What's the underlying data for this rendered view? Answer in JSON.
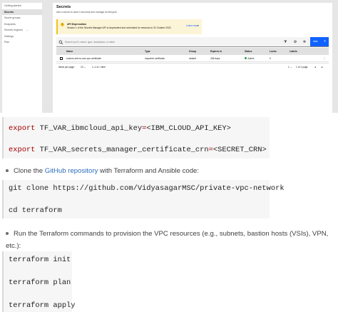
{
  "sidebar": {
    "items": [
      {
        "label": "Getting started"
      },
      {
        "label": "Secrets"
      },
      {
        "label": "Secret groups"
      },
      {
        "label": "Endpoints"
      },
      {
        "label": "Secrets engines"
      },
      {
        "label": "Settings"
      },
      {
        "label": "Plan"
      }
    ]
  },
  "page": {
    "title": "Secrets",
    "subtitle": "Add a secret to store it securely and manage its lifecycle."
  },
  "notice": {
    "title": "API Deprecation",
    "body": "Version 1 of the Secrets Manager API is deprecated and scheduled for removal on 31 October 2023.",
    "link": "Learn more"
  },
  "toolbar": {
    "search_placeholder": "Search by ID, name, type, description, or label",
    "add_label": "Add"
  },
  "table": {
    "columns": [
      "Name",
      "Type",
      "Group",
      "Expires in",
      "Status",
      "Locks",
      "Labels"
    ],
    "rows": [
      {
        "name": "custom-cert-to-use-vpn-certificate",
        "type": "Imported certificate",
        "group": "default",
        "expires": "436 days",
        "status": "Active",
        "locks": "0",
        "labels": ""
      }
    ]
  },
  "pager": {
    "items_per_page_label": "Items per page:",
    "per_page": "10",
    "range": "1–1 of 1 item",
    "page": "1",
    "of_pages": "1 of 1 page"
  },
  "code1": {
    "line1_kw": "export",
    "line1_name": "TF_VAR_ibmcloud_api_key",
    "line1_op": "=",
    "line1_val": "<IBM_CLOUD_API_KEY>",
    "line2_kw": "export",
    "line2_name": "TF_VAR_secrets_manager_certificate_crn",
    "line2_op": "=",
    "line2_val": "<SECRET_CRN>"
  },
  "bullet1": {
    "prefix": "Clone the ",
    "link": "GitHub repository",
    "suffix": " with Terraform and Ansible code:"
  },
  "code2": {
    "line1": "git clone https://github.com/VidyasagarMSC/private-vpc-network",
    "line2": "cd terraform"
  },
  "bullet2": {
    "line1": "Run the Terraform commands to provision the VPC resources (e.g., subnets, bastion hosts (VSIs), VPN,",
    "line2": "etc.):"
  },
  "code3": {
    "line1": "terraform init",
    "line2": "terraform plan",
    "line3": "terraform apply"
  },
  "colors": {
    "primary": "#0f62fe",
    "warning": "#f1c21b",
    "active": "#24a148",
    "code_keyword": "#a30000",
    "link": "#2a6ebb"
  }
}
